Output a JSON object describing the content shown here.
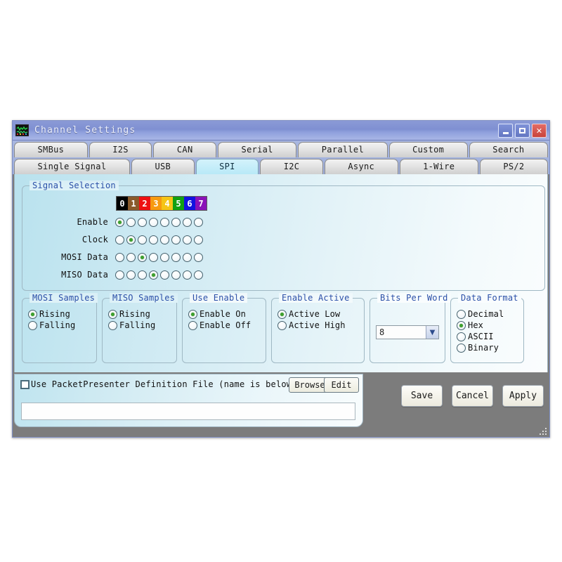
{
  "window": {
    "title": "Channel Settings",
    "app_icon": "waveform-icon",
    "minimize_label": "_",
    "maximize_label": "□",
    "close_label": "X"
  },
  "tabs": {
    "row1": [
      {
        "label": "SMBus",
        "selected": false
      },
      {
        "label": "I2S",
        "selected": false
      },
      {
        "label": "CAN",
        "selected": false
      },
      {
        "label": "Serial",
        "selected": false
      },
      {
        "label": "Parallel",
        "selected": false
      },
      {
        "label": "Custom",
        "selected": false
      },
      {
        "label": "Search",
        "selected": false
      }
    ],
    "row2": [
      {
        "label": "Single Signal",
        "selected": false
      },
      {
        "label": "USB",
        "selected": false
      },
      {
        "label": "SPI",
        "selected": true
      },
      {
        "label": "I2C",
        "selected": false
      },
      {
        "label": "Async",
        "selected": false
      },
      {
        "label": "1-Wire",
        "selected": false
      },
      {
        "label": "PS/2",
        "selected": false
      }
    ]
  },
  "signal_selection": {
    "title": "Signal Selection",
    "channels": [
      {
        "index": "0",
        "color": "#000000"
      },
      {
        "index": "1",
        "color": "#8a5a2b"
      },
      {
        "index": "2",
        "color": "#ee1111"
      },
      {
        "index": "3",
        "color": "#f79a10"
      },
      {
        "index": "4",
        "color": "#f5c518"
      },
      {
        "index": "5",
        "color": "#12a012"
      },
      {
        "index": "6",
        "color": "#1212e0"
      },
      {
        "index": "7",
        "color": "#8a12b8"
      }
    ],
    "rows": [
      {
        "label": "Enable",
        "selected": 0
      },
      {
        "label": "Clock",
        "selected": 1
      },
      {
        "label": "MOSI Data",
        "selected": 2
      },
      {
        "label": "MISO Data",
        "selected": 3
      }
    ]
  },
  "mosi_samples": {
    "title": "MOSI Samples",
    "options": [
      {
        "label": "Rising",
        "selected": true
      },
      {
        "label": "Falling",
        "selected": false
      }
    ]
  },
  "miso_samples": {
    "title": "MISO Samples",
    "options": [
      {
        "label": "Rising",
        "selected": true
      },
      {
        "label": "Falling",
        "selected": false
      }
    ]
  },
  "use_enable": {
    "title": "Use Enable",
    "options": [
      {
        "label": "Enable On",
        "selected": true
      },
      {
        "label": "Enable Off",
        "selected": false
      }
    ]
  },
  "enable_active": {
    "title": "Enable Active",
    "options": [
      {
        "label": "Active Low",
        "selected": true
      },
      {
        "label": "Active High",
        "selected": false
      }
    ]
  },
  "bits_per_word": {
    "title": "Bits Per Word",
    "value": "8",
    "arrow_icon": "chevron-down-icon"
  },
  "data_format": {
    "title": "Data Format",
    "options": [
      {
        "label": "Decimal",
        "selected": false
      },
      {
        "label": "Hex",
        "selected": true
      },
      {
        "label": "ASCII",
        "selected": false
      },
      {
        "label": "Binary",
        "selected": false
      }
    ]
  },
  "packet_presenter": {
    "checkbox_label": "Use PacketPresenter Definition File (name is below)",
    "checked": false,
    "browse_label": "Browse",
    "edit_label": "Edit",
    "filename_value": "",
    "filename_placeholder": ""
  },
  "actions": [
    {
      "label": "Save"
    },
    {
      "label": "Cancel"
    },
    {
      "label": "Apply"
    }
  ],
  "colors": {
    "titlebar": "#8b9ad6",
    "selected_tab": "#b8e9f7",
    "group_label": "#2b50a8",
    "radio_on": "#3ea02e",
    "close_button": "#c8433c",
    "bottom_strip": "#7c7c7c"
  }
}
